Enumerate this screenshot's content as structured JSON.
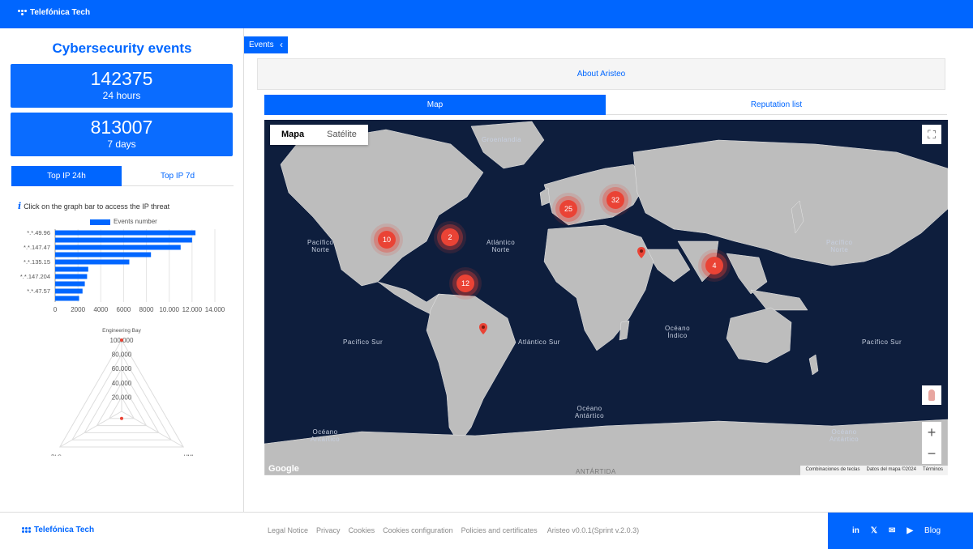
{
  "header": {
    "brand": "Telefónica Tech"
  },
  "left": {
    "title": "Cybersecurity events",
    "stats": [
      {
        "value": "142375",
        "label": "24 hours"
      },
      {
        "value": "813007",
        "label": "7 days"
      }
    ],
    "tabs": [
      {
        "label": "Top IP 24h",
        "active": true
      },
      {
        "label": "Top IP 7d",
        "active": false
      }
    ],
    "hint": "Click on the graph bar to access the IP threat",
    "legend": "Events number"
  },
  "chart_data": [
    {
      "type": "bar",
      "orientation": "horizontal",
      "legend": [
        "Events number"
      ],
      "categories": [
        "*.*.49.96",
        "",
        "*.*.147.47",
        "",
        "*.*.135.15",
        "",
        "*.*.147.204",
        "",
        "*.*.47.57",
        ""
      ],
      "values": [
        12300,
        12000,
        11000,
        8400,
        6500,
        2900,
        2800,
        2600,
        2400,
        2100
      ],
      "xticks": [
        "0",
        "2000",
        "4000",
        "6000",
        "8000",
        "10.000",
        "12.000",
        "14.000"
      ],
      "xlim": [
        0,
        14000
      ],
      "grid": true
    },
    {
      "type": "radar",
      "axes": [
        "Engineering Bay",
        "PLC",
        "HMI"
      ],
      "rticks": [
        "20.000",
        "40.000",
        "60.000",
        "80.000",
        "100.000"
      ],
      "rlim": [
        0,
        100000
      ],
      "points": [
        {
          "axis": "Engineering Bay",
          "value": 100000
        },
        {
          "axis": "center",
          "value": 10000
        }
      ]
    }
  ],
  "right": {
    "events_label": "Events",
    "about_label": "About Aristeo",
    "tabs": [
      {
        "label": "Map",
        "active": true
      },
      {
        "label": "Reputation list",
        "active": false
      }
    ]
  },
  "map": {
    "type_buttons": [
      "Mapa",
      "Satélite"
    ],
    "labels": {
      "pac_norte_w": "Pacífico\nNorte",
      "atl_norte": "Atlántico\nNorte",
      "pac_norte_e": "Pacífico\nNorte",
      "pac_sur_w": "Pacífico Sur",
      "atl_sur": "Atlántico Sur",
      "indico": "Océano\nÍndico",
      "pac_sur_e": "Pacífico Sur",
      "ant_1": "Océano\nAntártico",
      "ant_2": "Océano\nAntártico",
      "ant_3": "Océano\nAntártico",
      "antartida": "ANTÁRTIDA",
      "groenlandia": "Groenlandia"
    },
    "clusters": [
      "10",
      "2",
      "25",
      "32",
      "12",
      "4"
    ],
    "google": "Google",
    "attribution": [
      "Combinaciones de teclas",
      "Datos del mapa ©2024",
      "Términos"
    ],
    "icons": [
      "fullscreen-icon",
      "pegman-icon",
      "zoom-in-icon",
      "zoom-out-icon",
      "map-pin-icon"
    ],
    "cluster_color": "#ea4335"
  },
  "footer": {
    "brand": "Telefónica Tech",
    "links": [
      "Legal Notice",
      "Privacy",
      "Cookies",
      "Cookies configuration",
      "Policies and certificates"
    ],
    "version": "Aristeo v0.0.1(Sprint v.2.0.3)",
    "social": [
      "in",
      "𝕏",
      "✉",
      "▶"
    ],
    "blog": "Blog"
  },
  "colors": {
    "accent": "#0066ff",
    "map_ocean": "#0e1e3d",
    "map_land": "#bdbdbd",
    "cluster": "#ea4335"
  }
}
